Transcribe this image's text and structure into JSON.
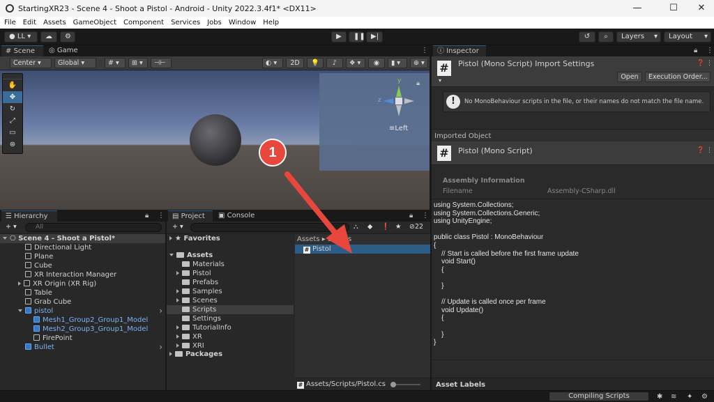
{
  "window": {
    "title": "StartingXR23 - Scene 4 - Shoot a Pistol - Android - Unity 2022.3.4f1* <DX11>",
    "controls": {
      "minimize": "—",
      "maximize": "☐",
      "close": "✕"
    }
  },
  "menu": [
    "File",
    "Edit",
    "Assets",
    "GameObject",
    "Component",
    "Services",
    "Jobs",
    "Window",
    "Help"
  ],
  "toolbar": {
    "account": "LL",
    "layers": "Layers",
    "layout": "Layout"
  },
  "scene_panel": {
    "tabs": [
      "Scene",
      "Game"
    ],
    "center": "Center",
    "global": "Global",
    "mode_2d": "2D",
    "gizmo_view": "Left",
    "gizmo_y": "y",
    "gizmo_z": "z"
  },
  "hierarchy": {
    "tab": "Hierarchy",
    "search_placeholder": "All",
    "items": [
      {
        "label": "Scene 4 - Shoot a Pistol*",
        "depth": 0,
        "kind": "scene"
      },
      {
        "label": "Directional Light",
        "depth": 1,
        "kind": "obj"
      },
      {
        "label": "Plane",
        "depth": 1,
        "kind": "obj"
      },
      {
        "label": "Cube",
        "depth": 1,
        "kind": "obj"
      },
      {
        "label": "XR Interaction Manager",
        "depth": 1,
        "kind": "obj"
      },
      {
        "label": "XR Origin (XR Rig)",
        "depth": 1,
        "kind": "obj"
      },
      {
        "label": "Table",
        "depth": 1,
        "kind": "obj"
      },
      {
        "label": "Grab Cube",
        "depth": 1,
        "kind": "obj"
      },
      {
        "label": "pistol",
        "depth": 1,
        "kind": "prefab"
      },
      {
        "label": "Mesh1_Group2_Group1_Model",
        "depth": 2,
        "kind": "prefab"
      },
      {
        "label": "Mesh2_Group3_Group1_Model",
        "depth": 2,
        "kind": "prefab"
      },
      {
        "label": "FirePoint",
        "depth": 2,
        "kind": "obj"
      },
      {
        "label": "Bullet",
        "depth": 1,
        "kind": "prefab"
      }
    ]
  },
  "project": {
    "tabs": [
      "Project",
      "Console"
    ],
    "hidden_count": "22",
    "favorites": "Favorites",
    "assets_root": "Assets",
    "folders": [
      "Materials",
      "Pistol",
      "Prefabs",
      "Samples",
      "Scenes",
      "Scripts",
      "Settings",
      "TutorialInfo",
      "XR",
      "XRI"
    ],
    "packages": "Packages",
    "breadcrumb_assets": "Assets",
    "breadcrumb_scripts": "Scripts",
    "selected_asset": "Pistol",
    "footer_path": "Assets/Scripts/Pistol.cs"
  },
  "inspector": {
    "tab": "Inspector",
    "header_title": "Pistol (Mono Script) Import Settings",
    "open_button": "Open",
    "execution_order_button": "Execution Order...",
    "warning": "No MonoBehaviour scripts in the file, or their names do not match the file name.",
    "imported_object_label": "Imported Object",
    "object_title": "Pistol (Mono Script)",
    "assembly_info_label": "Assembly Information",
    "filename_label": "Filename",
    "filename_value": "Assembly-CSharp.dll",
    "code_lines": [
      "using System.Collections;",
      "using System.Collections.Generic;",
      "using UnityEngine;",
      "",
      "public class Pistol : MonoBehaviour",
      "{",
      "    // Start is called before the first frame update",
      "    void Start()",
      "    {",
      "",
      "    }",
      "",
      "    // Update is called once per frame",
      "    void Update()",
      "    {",
      "",
      "    }",
      "}"
    ],
    "asset_labels": "Asset Labels"
  },
  "status_bar": {
    "compiling": "Compiling Scripts"
  },
  "annotation": {
    "number": "1"
  },
  "colors": {
    "accent_blue": "#2c5d87",
    "prefab_blue": "#7cb3f5",
    "annotation_red": "#e8473d"
  }
}
